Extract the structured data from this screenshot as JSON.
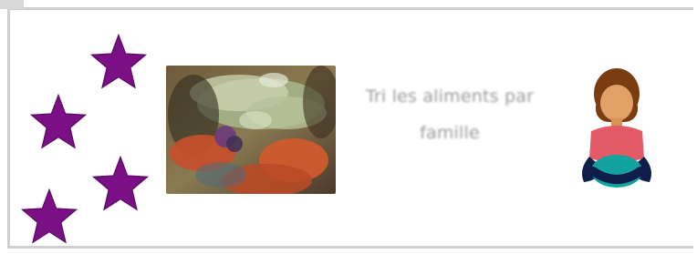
{
  "activity": {
    "title": "Tri les aliments par famille"
  },
  "icons": {
    "stars": "star-icon",
    "avatar": "child-avatar-icon"
  },
  "colors": {
    "star": "#7b0f86",
    "frame": "#cfcfcf",
    "title": "#9a9a9a"
  }
}
